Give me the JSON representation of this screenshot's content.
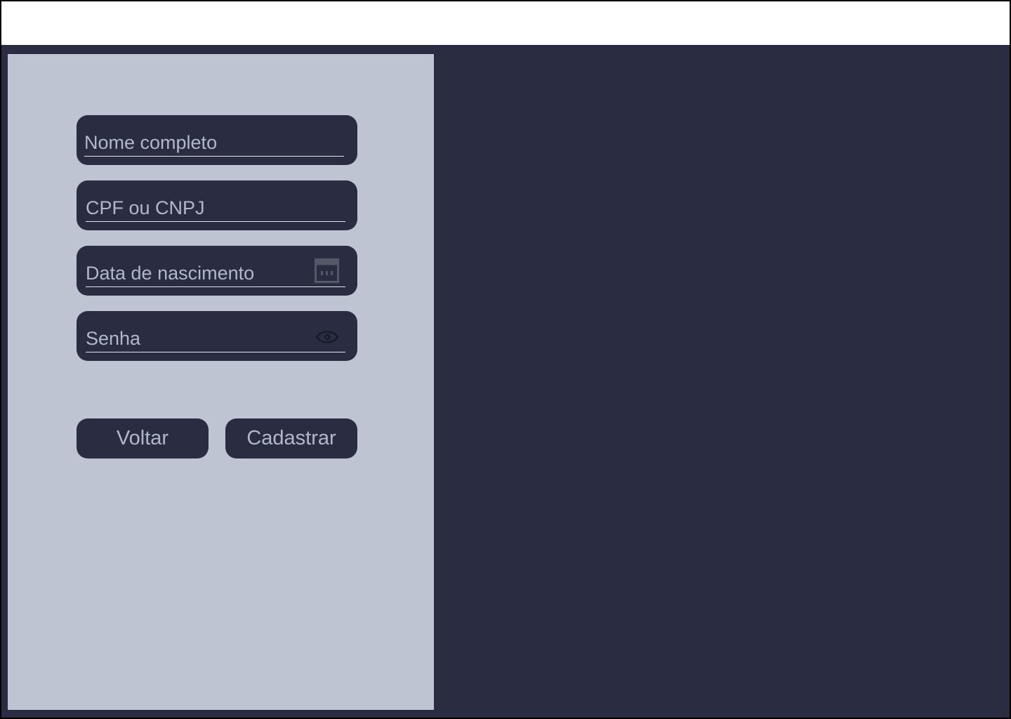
{
  "form": {
    "fields": [
      {
        "label": "Nome completo",
        "icon": ""
      },
      {
        "label": "CPF ou CNPJ",
        "icon": ""
      },
      {
        "label": "Data de nascimento",
        "icon": "calendar-icon"
      },
      {
        "label": "Senha",
        "icon": "eye-icon"
      }
    ],
    "buttons": {
      "back_label": "Voltar",
      "submit_label": "Cadastrar"
    }
  },
  "colors": {
    "background": "#2a2d41",
    "panel": "#bec4d2",
    "field_bg": "#2a2d41",
    "text": "#b2b8cb",
    "topbar": "#ffffff"
  }
}
